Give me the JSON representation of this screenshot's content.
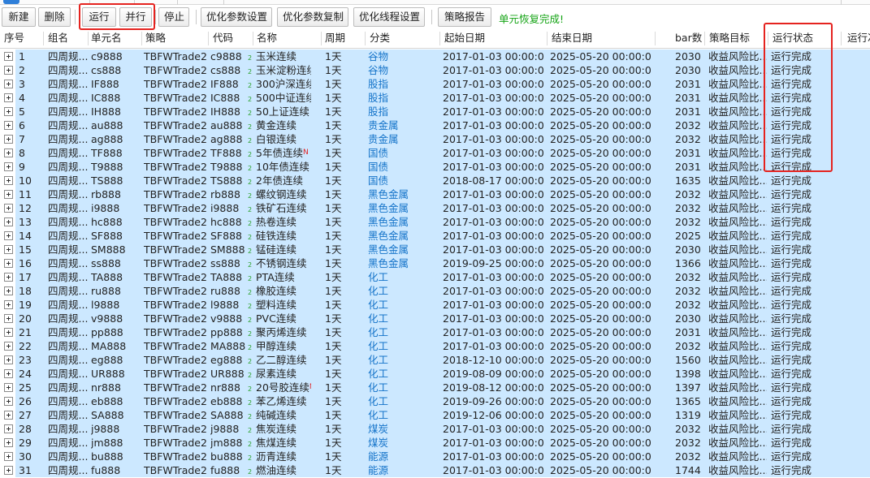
{
  "toolbar": {
    "buttons": [
      "新建",
      "删除",
      "运行",
      "并行",
      "停止",
      "优化参数设置",
      "优化参数复制",
      "优化线程设置",
      "策略报告"
    ],
    "status": "单元恢复完成!"
  },
  "columns": [
    "序号",
    "组名",
    "单元名",
    "策略",
    "代码",
    "名称",
    "周期",
    "分类",
    "起始日期",
    "结束日期",
    "bar数",
    "策略目标",
    "运行状态",
    "运行次"
  ],
  "rows": [
    [
      "1",
      "四周规...",
      "c9888",
      "TBFWTrade2",
      "c9888",
      "玉米连续",
      "1天",
      "谷物",
      "2017-01-03 00:00:00",
      "2025-05-20 00:00:00",
      "2030",
      "收益风险比...",
      "运行完成"
    ],
    [
      "2",
      "四周规...",
      "cs888",
      "TBFWTrade2",
      "cs888",
      "玉米淀粉连续",
      "1天",
      "谷物",
      "2017-01-03 00:00:00",
      "2025-05-20 00:00:00",
      "2030",
      "收益风险比...",
      "运行完成"
    ],
    [
      "3",
      "四周规...",
      "IF888",
      "TBFWTrade2",
      "IF888",
      "300沪深连续",
      "1天",
      "股指",
      "2017-01-03 00:00:00",
      "2025-05-20 00:00:00",
      "2031",
      "收益风险比...",
      "运行完成"
    ],
    [
      "4",
      "四周规...",
      "IC888",
      "TBFWTrade2",
      "IC888",
      "500中证连续",
      "1天",
      "股指",
      "2017-01-03 00:00:00",
      "2025-05-20 00:00:00",
      "2031",
      "收益风险比...",
      "运行完成"
    ],
    [
      "5",
      "四周规...",
      "IH888",
      "TBFWTrade2",
      "IH888",
      "50上证连续",
      "1天",
      "股指",
      "2017-01-03 00:00:00",
      "2025-05-20 00:00:00",
      "2031",
      "收益风险比...",
      "运行完成"
    ],
    [
      "6",
      "四周规...",
      "au888",
      "TBFWTrade2",
      "au888",
      "黄金连续",
      "1天",
      "贵金属",
      "2017-01-03 00:00:00",
      "2025-05-20 00:00:00",
      "2032",
      "收益风险比...",
      "运行完成"
    ],
    [
      "7",
      "四周规...",
      "ag888",
      "TBFWTrade2",
      "ag888",
      "白银连续",
      "1天",
      "贵金属",
      "2017-01-03 00:00:00",
      "2025-05-20 00:00:00",
      "2032",
      "收益风险比...",
      "运行完成"
    ],
    [
      "8",
      "四周规...",
      "TF888",
      "TBFWTrade2",
      "TF888",
      "5年债连续",
      "1天",
      "国债",
      "2017-01-03 00:00:00",
      "2025-05-20 00:00:00",
      "2031",
      "收益风险比...",
      "运行完成"
    ],
    [
      "9",
      "四周规...",
      "T9888",
      "TBFWTrade2",
      "T9888",
      "10年债连续",
      "1天",
      "国债",
      "2017-01-03 00:00:00",
      "2025-05-20 00:00:00",
      "2031",
      "收益风险比...",
      "运行完成"
    ],
    [
      "10",
      "四周规...",
      "TS888",
      "TBFWTrade2",
      "TS888",
      "2年债连续",
      "1天",
      "国债",
      "2018-08-17 00:00:00",
      "2025-05-20 00:00:00",
      "1635",
      "收益风险比...",
      "运行完成"
    ],
    [
      "11",
      "四周规...",
      "rb888",
      "TBFWTrade2",
      "rb888",
      "螺纹钢连续",
      "1天",
      "黑色金属",
      "2017-01-03 00:00:00",
      "2025-05-20 00:00:00",
      "2032",
      "收益风险比...",
      "运行完成"
    ],
    [
      "12",
      "四周规...",
      "i9888",
      "TBFWTrade2",
      "i9888",
      "铁矿石连续",
      "1天",
      "黑色金属",
      "2017-01-03 00:00:00",
      "2025-05-20 00:00:00",
      "2032",
      "收益风险比...",
      "运行完成"
    ],
    [
      "13",
      "四周规...",
      "hc888",
      "TBFWTrade2",
      "hc888",
      "热卷连续",
      "1天",
      "黑色金属",
      "2017-01-03 00:00:00",
      "2025-05-20 00:00:00",
      "2032",
      "收益风险比...",
      "运行完成"
    ],
    [
      "14",
      "四周规...",
      "SF888",
      "TBFWTrade2",
      "SF888",
      "硅铁连续",
      "1天",
      "黑色金属",
      "2017-01-03 00:00:00",
      "2025-05-20 00:00:00",
      "2025",
      "收益风险比...",
      "运行完成"
    ],
    [
      "15",
      "四周规...",
      "SM888",
      "TBFWTrade2",
      "SM888",
      "锰硅连续",
      "1天",
      "黑色金属",
      "2017-01-03 00:00:00",
      "2025-05-20 00:00:00",
      "2030",
      "收益风险比...",
      "运行完成"
    ],
    [
      "16",
      "四周规...",
      "ss888",
      "TBFWTrade2",
      "ss888",
      "不锈钢连续",
      "1天",
      "黑色金属",
      "2019-09-25 00:00:00",
      "2025-05-20 00:00:00",
      "1366",
      "收益风险比...",
      "运行完成"
    ],
    [
      "17",
      "四周规...",
      "TA888",
      "TBFWTrade2",
      "TA888",
      "PTA连续",
      "1天",
      "化工",
      "2017-01-03 00:00:00",
      "2025-05-20 00:00:00",
      "2032",
      "收益风险比...",
      "运行完成"
    ],
    [
      "18",
      "四周规...",
      "ru888",
      "TBFWTrade2",
      "ru888",
      "橡胶连续",
      "1天",
      "化工",
      "2017-01-03 00:00:00",
      "2025-05-20 00:00:00",
      "2032",
      "收益风险比...",
      "运行完成"
    ],
    [
      "19",
      "四周规...",
      "l9888",
      "TBFWTrade2",
      "l9888",
      "塑料连续",
      "1天",
      "化工",
      "2017-01-03 00:00:00",
      "2025-05-20 00:00:00",
      "2032",
      "收益风险比...",
      "运行完成"
    ],
    [
      "20",
      "四周规...",
      "v9888",
      "TBFWTrade2",
      "v9888",
      "PVC连续",
      "1天",
      "化工",
      "2017-01-03 00:00:00",
      "2025-05-20 00:00:00",
      "2030",
      "收益风险比...",
      "运行完成"
    ],
    [
      "21",
      "四周规...",
      "pp888",
      "TBFWTrade2",
      "pp888",
      "聚丙烯连续",
      "1天",
      "化工",
      "2017-01-03 00:00:00",
      "2025-05-20 00:00:00",
      "2031",
      "收益风险比...",
      "运行完成"
    ],
    [
      "22",
      "四周规...",
      "MA888",
      "TBFWTrade2",
      "MA888",
      "甲醇连续",
      "1天",
      "化工",
      "2017-01-03 00:00:00",
      "2025-05-20 00:00:00",
      "2032",
      "收益风险比...",
      "运行完成"
    ],
    [
      "23",
      "四周规...",
      "eg888",
      "TBFWTrade2",
      "eg888",
      "乙二醇连续",
      "1天",
      "化工",
      "2018-12-10 00:00:00",
      "2025-05-20 00:00:00",
      "1560",
      "收益风险比...",
      "运行完成"
    ],
    [
      "24",
      "四周规...",
      "UR888",
      "TBFWTrade2",
      "UR888",
      "尿素连续",
      "1天",
      "化工",
      "2019-08-09 00:00:00",
      "2025-05-20 00:00:00",
      "1398",
      "收益风险比...",
      "运行完成"
    ],
    [
      "25",
      "四周规...",
      "nr888",
      "TBFWTrade2",
      "nr888",
      "20号胶连续",
      "1天",
      "化工",
      "2019-08-12 00:00:00",
      "2025-05-20 00:00:00",
      "1397",
      "收益风险比...",
      "运行完成"
    ],
    [
      "26",
      "四周规...",
      "eb888",
      "TBFWTrade2",
      "eb888",
      "苯乙烯连续",
      "1天",
      "化工",
      "2019-09-26 00:00:00",
      "2025-05-20 00:00:00",
      "1365",
      "收益风险比...",
      "运行完成"
    ],
    [
      "27",
      "四周规...",
      "SA888",
      "TBFWTrade2",
      "SA888",
      "纯碱连续",
      "1天",
      "化工",
      "2019-12-06 00:00:00",
      "2025-05-20 00:00:00",
      "1319",
      "收益风险比...",
      "运行完成"
    ],
    [
      "28",
      "四周规...",
      "j9888",
      "TBFWTrade2",
      "j9888",
      "焦炭连续",
      "1天",
      "煤炭",
      "2017-01-03 00:00:00",
      "2025-05-20 00:00:00",
      "2032",
      "收益风险比...",
      "运行完成"
    ],
    [
      "29",
      "四周规...",
      "jm888",
      "TBFWTrade2",
      "jm888",
      "焦煤连续",
      "1天",
      "煤炭",
      "2017-01-03 00:00:00",
      "2025-05-20 00:00:00",
      "2032",
      "收益风险比...",
      "运行完成"
    ],
    [
      "30",
      "四周规...",
      "bu888",
      "TBFWTrade2",
      "bu888",
      "沥青连续",
      "1天",
      "能源",
      "2017-01-03 00:00:00",
      "2025-05-20 00:00:00",
      "2032",
      "收益风险比...",
      "运行完成"
    ],
    [
      "31",
      "四周规...",
      "fu888",
      "TBFWTrade2",
      "fu888",
      "燃油连续",
      "1天",
      "能源",
      "2017-01-03 00:00:00",
      "2025-05-20 00:00:00",
      "1744",
      "收益风险比...",
      "运行完成"
    ]
  ],
  "name_flags": {
    "8": "N",
    "25": "N"
  },
  "trade_icon": "2",
  "colors": {
    "row_bg": "#cce8ff",
    "category": "#1473c9",
    "status_ok": "#13a313",
    "highlight": "#e5231f"
  }
}
